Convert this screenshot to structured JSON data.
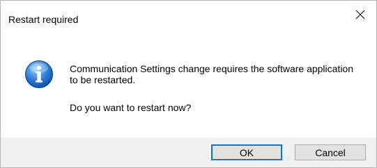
{
  "dialog": {
    "title": "Restart required",
    "icon": "information-icon",
    "message_line1": "Communication Settings change requires the software application to be restarted.",
    "message_line2": "Do you want to restart now?",
    "buttons": {
      "ok_label": "OK",
      "cancel_label": "Cancel"
    }
  },
  "colors": {
    "accent": "#0078d7",
    "footer_bg": "#f0f0f0",
    "button_bg": "#e1e1e1"
  }
}
